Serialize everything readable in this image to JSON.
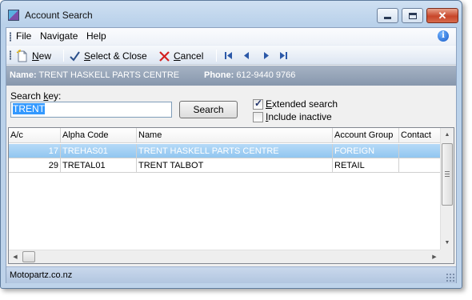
{
  "window": {
    "title": "Account Search",
    "close_glyph": "✕"
  },
  "menu": {
    "file": "File",
    "navigate": "Navigate",
    "help": "Help",
    "info_glyph": "i"
  },
  "toolbar": {
    "new_label": "ew",
    "new_key": "N",
    "select_close_key": "S",
    "select_close_label": "elect & Close",
    "cancel_key": "C",
    "cancel_label": "ancel"
  },
  "banner": {
    "name_label": "Name:",
    "name_value": "TRENT HASKELL PARTS CENTRE",
    "phone_label": "Phone:",
    "phone_value": "612-9440 9766"
  },
  "search": {
    "label_prefix": "Search ",
    "label_key": "k",
    "label_suffix": "ey:",
    "value": "TRENT",
    "button_label": "Search"
  },
  "options": {
    "extended_key": "E",
    "extended_label": "xtended search",
    "extended_checked": true,
    "inactive_key": "I",
    "inactive_label": "nclude inactive",
    "inactive_checked": false
  },
  "grid": {
    "columns": [
      "A/c",
      "Alpha Code",
      "Name",
      "Account Group",
      "Contact"
    ],
    "rows": [
      {
        "ac": "17",
        "alpha": "TREHAS01",
        "name": "TRENT HASKELL PARTS CENTRE",
        "group": "FOREIGN",
        "contact": "",
        "selected": true
      },
      {
        "ac": "29",
        "alpha": "TRETAL01",
        "name": "TRENT TALBOT",
        "group": "RETAIL",
        "contact": "",
        "selected": false
      }
    ]
  },
  "status": {
    "text": "Motopartz.co.nz"
  },
  "colors": {
    "selection": "#8fc5f0",
    "banner": "#8797ad",
    "statusbar": "#b2c6e0"
  }
}
